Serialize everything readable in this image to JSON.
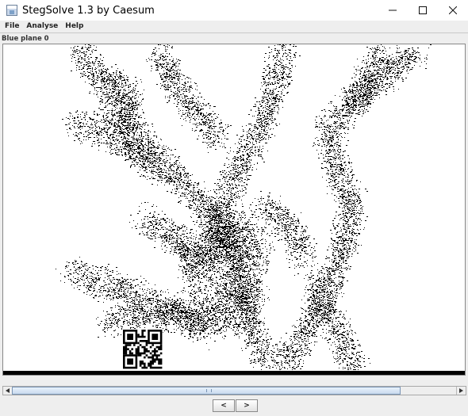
{
  "window": {
    "title": "StegSolve 1.3 by Caesum",
    "controls": {
      "minimize_icon": "minimize-icon",
      "maximize_icon": "maximize-icon",
      "close_icon": "close-icon"
    }
  },
  "menu": {
    "items": [
      {
        "label": "File"
      },
      {
        "label": "Analyse"
      },
      {
        "label": "Help"
      }
    ]
  },
  "plane": {
    "label": "Blue plane 0"
  },
  "navigation": {
    "prev_label": "<",
    "next_label": ">"
  },
  "colors": {
    "foreground": "#000000",
    "background": "#ffffff",
    "scroll_thumb": "#c9daee"
  }
}
